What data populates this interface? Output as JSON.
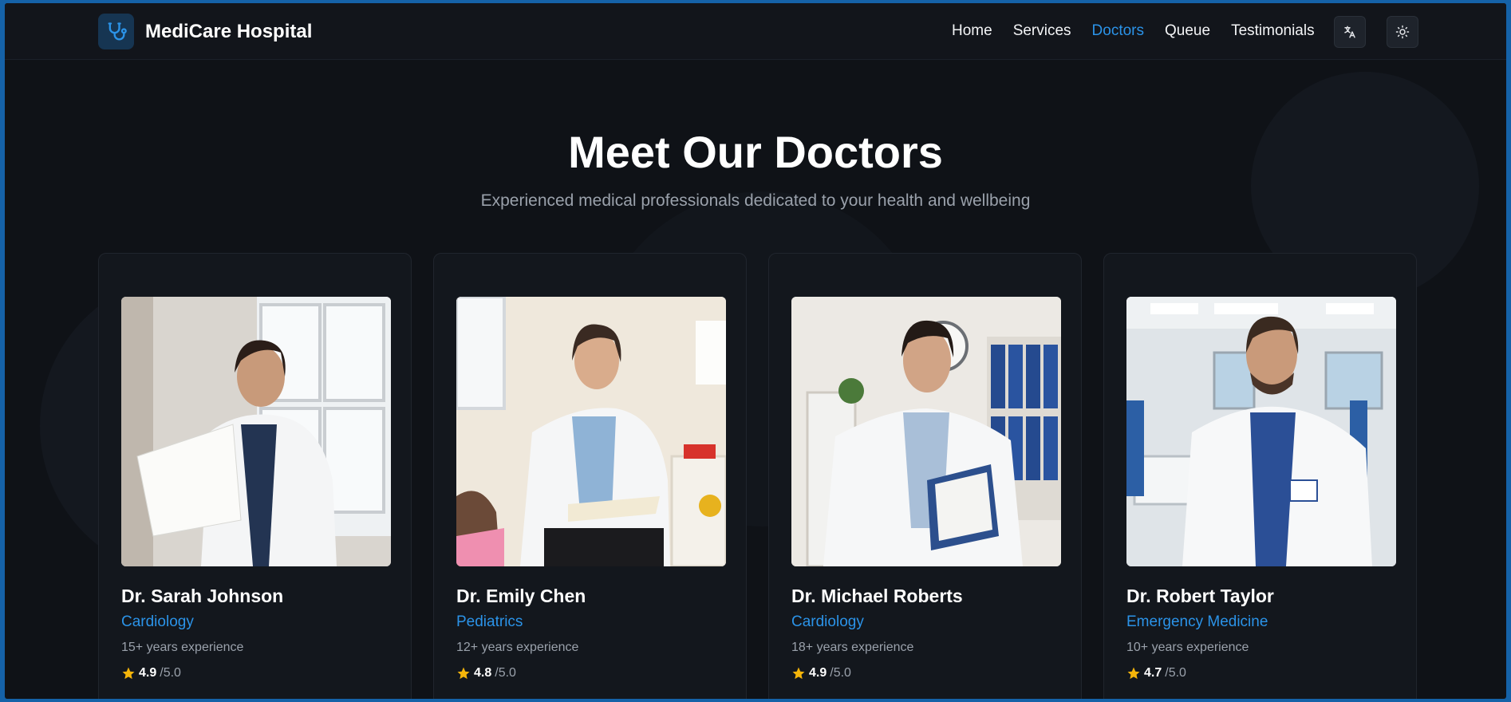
{
  "brand": {
    "name": "MediCare Hospital",
    "logo_icon": "stethoscope-icon",
    "accent": "#2b93e8"
  },
  "nav": {
    "items": [
      {
        "label": "Home",
        "active": false
      },
      {
        "label": "Services",
        "active": false
      },
      {
        "label": "Doctors",
        "active": true
      },
      {
        "label": "Queue",
        "active": false
      },
      {
        "label": "Testimonials",
        "active": false
      }
    ],
    "language_icon": "translate-icon",
    "theme_icon": "sun-icon"
  },
  "hero": {
    "title": "Meet Our Doctors",
    "subtitle": "Experienced medical professionals dedicated to your health and wellbeing"
  },
  "doctors": [
    {
      "name": "Dr. Sarah Johnson",
      "specialty": "Cardiology",
      "experience": "15+ years experience",
      "rating": "4.9",
      "rating_max": "/5.0"
    },
    {
      "name": "Dr. Emily Chen",
      "specialty": "Pediatrics",
      "experience": "12+ years experience",
      "rating": "4.8",
      "rating_max": "/5.0"
    },
    {
      "name": "Dr. Michael Roberts",
      "specialty": "Cardiology",
      "experience": "18+ years experience",
      "rating": "4.9",
      "rating_max": "/5.0"
    },
    {
      "name": "Dr. Robert Taylor",
      "specialty": "Emergency Medicine",
      "experience": "10+ years experience",
      "rating": "4.7",
      "rating_max": "/5.0"
    }
  ],
  "colors": {
    "star": "#f5b50a",
    "background": "#0f1217",
    "frame": "#1562a8"
  }
}
